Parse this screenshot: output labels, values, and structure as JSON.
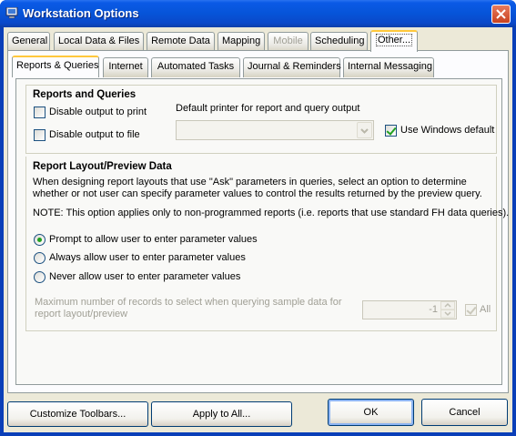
{
  "window": {
    "title": "Workstation Options",
    "close_icon": "close-icon",
    "app_icon": "computer-icon"
  },
  "outer_tabs": [
    {
      "label": "General",
      "state": "normal"
    },
    {
      "label": "Local Data & Files",
      "state": "normal"
    },
    {
      "label": "Remote Data",
      "state": "normal"
    },
    {
      "label": "Mapping",
      "state": "normal"
    },
    {
      "label": "Mobile",
      "state": "disabled"
    },
    {
      "label": "Scheduling",
      "state": "normal"
    },
    {
      "label": "Other...",
      "state": "active"
    }
  ],
  "inner_tabs": [
    {
      "label": "Reports & Queries",
      "state": "active"
    },
    {
      "label": "Internet",
      "state": "normal"
    },
    {
      "label": "Automated Tasks",
      "state": "normal"
    },
    {
      "label": "Journal & Reminders",
      "state": "normal"
    },
    {
      "label": "Internal Messaging",
      "state": "normal"
    }
  ],
  "reports_queries": {
    "heading": "Reports and Queries",
    "disable_print": {
      "label": "Disable output to print",
      "checked": false
    },
    "disable_file": {
      "label": "Disable output to file",
      "checked": false
    },
    "printer_label": "Default printer for report and query output",
    "printer_value": "",
    "use_windows_default": {
      "label": "Use Windows default",
      "checked": true
    }
  },
  "layout_preview": {
    "heading": "Report Layout/Preview Data",
    "description_line1": "When designing report layouts that use \"Ask\" parameters in queries, select an option to determine",
    "description_line2": "whether or not user can specify parameter values to control the results returned by the preview query.",
    "note": "NOTE: This option applies only to non-programmed reports (i.e. reports that use standard FH data queries).",
    "options": [
      {
        "label": "Prompt to allow user to enter parameter values",
        "selected": true
      },
      {
        "label": "Always allow user to enter parameter values",
        "selected": false
      },
      {
        "label": "Never allow user to enter parameter values",
        "selected": false
      }
    ],
    "max_records_line1": "Maximum number of records to select when querying sample data for",
    "max_records_line2": "report layout/preview",
    "max_records_value": "-1",
    "all": {
      "label": "All",
      "checked": true
    }
  },
  "buttons": {
    "customize_toolbars": "Customize Toolbars...",
    "apply_to_all": "Apply to All...",
    "ok": "OK",
    "cancel": "Cancel"
  },
  "colors": {
    "titlebar": "#0654d8",
    "client_bg": "#ece9d8",
    "active_tab_highlight": "#ffc83c",
    "check_mark": "#21a121"
  }
}
